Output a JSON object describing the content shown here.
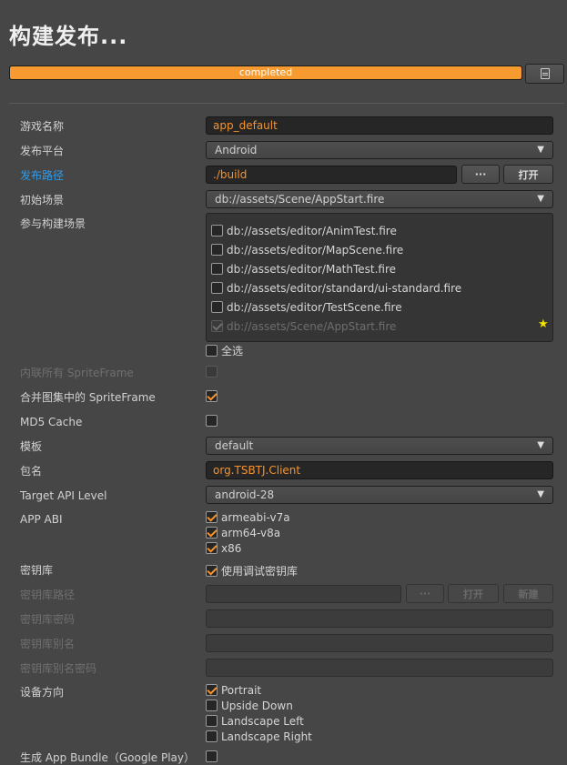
{
  "title": "构建发布...",
  "progress": {
    "percent": 100,
    "text": "completed",
    "color": "#f79a30"
  },
  "colors": {
    "accent": "#f7932b",
    "link": "#2a9cf0",
    "background": "#464646"
  },
  "fields": {
    "game_name": {
      "label": "游戏名称",
      "value": "app_default"
    },
    "platform": {
      "label": "发布平台",
      "value": "Android"
    },
    "build_path": {
      "label": "发布路径",
      "value": "./build",
      "browse": "···",
      "open": "打开"
    },
    "start_scene": {
      "label": "初始场景",
      "value": "db://assets/Scene/AppStart.fire"
    },
    "included_scenes": {
      "label": "参与构建场景",
      "items": [
        "db://assets/editor/AnimTest.fire",
        "db://assets/editor/MapScene.fire",
        "db://assets/editor/MathTest.fire",
        "db://assets/editor/standard/ui-standard.fire",
        "db://assets/editor/TestScene.fire",
        "db://assets/Scene/AppStart.fire"
      ],
      "select_all": "全选"
    },
    "inline_spriteframes": {
      "label": "内联所有 SpriteFrame"
    },
    "merge_spriteframes": {
      "label": "合并图集中的 SpriteFrame"
    },
    "md5_cache": {
      "label": "MD5 Cache"
    },
    "template": {
      "label": "模板",
      "value": "default"
    },
    "package_name": {
      "label": "包名",
      "value": "org.TSBTJ.Client"
    },
    "target_api": {
      "label": "Target API Level",
      "value": "android-28"
    },
    "app_abi": {
      "label": "APP ABI",
      "options": [
        "armeabi-v7a",
        "arm64-v8a",
        "x86"
      ]
    },
    "keystore": {
      "label": "密钥库",
      "option": "使用调试密钥库"
    },
    "keystore_path": {
      "label": "密钥库路径",
      "browse": "···",
      "open": "打开",
      "new": "新建"
    },
    "keystore_password": {
      "label": "密钥库密码"
    },
    "keystore_alias": {
      "label": "密钥库别名"
    },
    "keystore_alias_password": {
      "label": "密钥库别名密码"
    },
    "orientation": {
      "label": "设备方向",
      "options": [
        "Portrait",
        "Upside Down",
        "Landscape Left",
        "Landscape Right"
      ]
    },
    "app_bundle": {
      "label": "生成 App Bundle（Google Play）"
    }
  }
}
